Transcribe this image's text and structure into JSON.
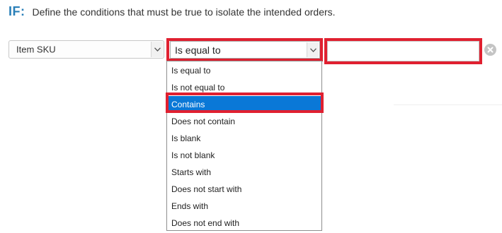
{
  "header": {
    "if_label": "IF:",
    "description": "Define the conditions that must be true to isolate the intended orders."
  },
  "condition": {
    "field": {
      "selected": "Item SKU"
    },
    "operator": {
      "selected": "Is equal to",
      "options": [
        "Is equal to",
        "Is not equal to",
        "Contains",
        "Does not contain",
        "Is blank",
        "Is not blank",
        "Starts with",
        "Does not start with",
        "Ends with",
        "Does not end with"
      ],
      "highlighted_option": "Contains"
    },
    "value": {
      "value": "",
      "placeholder": ""
    },
    "remove_icon": "close-circle-icon"
  },
  "colors": {
    "if_label": "#2a7fb8",
    "annotation_border": "#e02030",
    "option_highlight": "#0a78d7"
  }
}
